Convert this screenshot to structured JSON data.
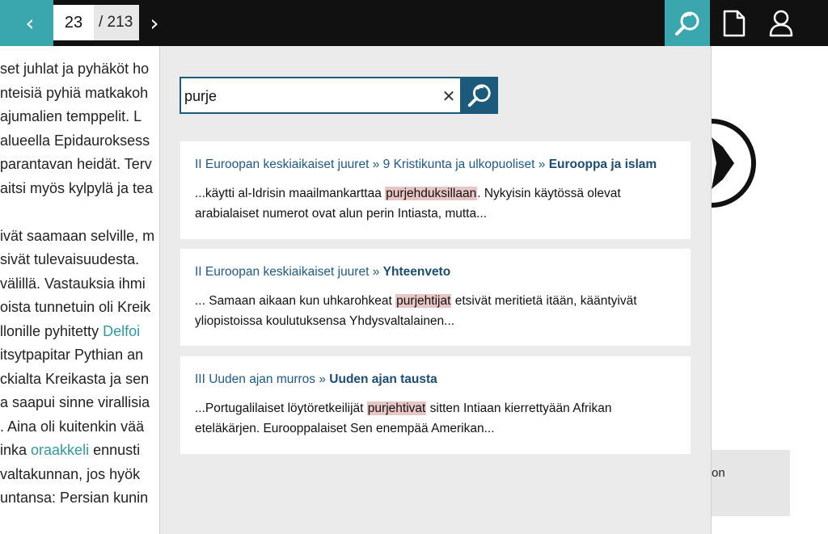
{
  "nav": {
    "prev_label": "‹",
    "next_label": "›",
    "current_page": "23",
    "total_pages": "/ 213"
  },
  "colors": {
    "accent": "#3aa6ad",
    "search_dark": "#1b5a7a",
    "highlight": "#e9c6c6"
  },
  "icons": {
    "search": "search-icon",
    "document": "document-icon",
    "user": "user-icon",
    "clear": "close-icon"
  },
  "background_text": [
    {
      "text": "set juhlat ja pyhäköt ho"
    },
    {
      "text": "nteisiä pyhiä matkakoh"
    },
    {
      "text": "ajumalien temppelit. L"
    },
    {
      "text": "alueella Epidauroksess"
    },
    {
      "text": "parantavan heidät. Terv"
    },
    {
      "text": "aitsi myös kylpylä ja tea"
    },
    {
      "text": ""
    },
    {
      "text": "ivät saamaan selville, m"
    },
    {
      "text": "sivät tulevaisuudesta."
    },
    {
      "text": "välillä. Vastauksia ihmi"
    },
    {
      "text": "oista tunnetuin oli Kreik"
    },
    {
      "text": "llonille pyhitetty ",
      "link": "Delfoi"
    },
    {
      "text": "itsytpapitar Pythian an"
    },
    {
      "text": "ckialta Kreikasta ja sen"
    },
    {
      "text": "a saapui sinne virallisia"
    },
    {
      "text": ". Aina oli kuitenkin vää"
    },
    {
      "text": "inka ",
      "link": "oraakkeli",
      "after": " ennusti"
    },
    {
      "text": " valtakunnan, jos hyök"
    },
    {
      "text": "untansa: Persian kunin"
    }
  ],
  "right_panel": {
    "gray_text": "on"
  },
  "search": {
    "query": "purje",
    "clear_label": "✕"
  },
  "results": [
    {
      "path": [
        "II Euroopan keskiaikaiset juuret",
        "9 Kristikunta ja ulkopuoliset"
      ],
      "final": "Eurooppa ja islam",
      "before": "...käytti al-Idrisin maailmankarttaa ",
      "match": "purjehduksillaan",
      "after": ". Nykyisin käytössä olevat arabialaiset numerot ovat alun perin Intiasta, mutta..."
    },
    {
      "path": [
        "II Euroopan keskiaikaiset juuret"
      ],
      "final": "Yhteenveto",
      "before": "... Samaan aikaan kun uhkarohkeat ",
      "match": "purjehtijat",
      "after": " etsivät meritietä itään, kääntyivät yliopistoissa koulutuksensa Yhdysvaltalainen..."
    },
    {
      "path": [
        "III Uuden ajan murros"
      ],
      "final": "Uuden ajan tausta",
      "before": "...Portugalilaiset löytöretkeilijät ",
      "match": "purjehtivat",
      "after": " sitten Intiaan kierrettyään Afrikan eteläkärjen. Eurooppalaiset Sen enempää Amerikan..."
    }
  ]
}
